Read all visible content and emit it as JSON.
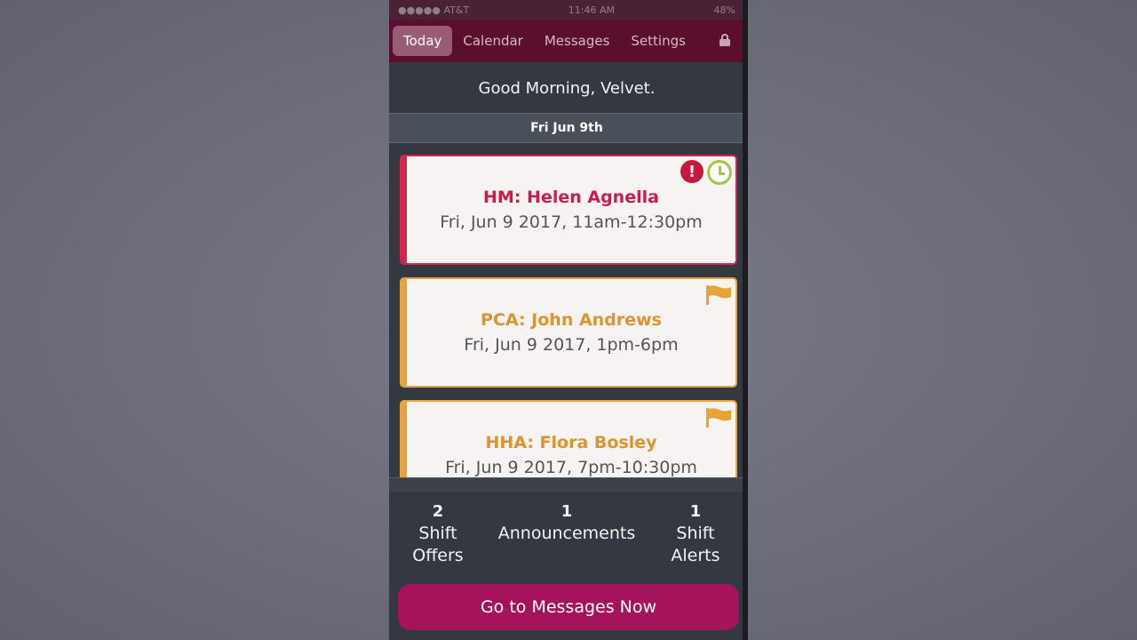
{
  "status_bar": {
    "carrier": "●●●●● AT&T",
    "time": "11:46 AM",
    "battery": "48%"
  },
  "nav": {
    "tabs": [
      {
        "label": "Today",
        "active": true
      },
      {
        "label": "Calendar",
        "active": false
      },
      {
        "label": "Messages",
        "active": false
      },
      {
        "label": "Settings",
        "active": false
      }
    ],
    "lock_icon": "lock-icon"
  },
  "greeting": "Good Morning, Velvet.",
  "date_header": "Fri Jun 9th",
  "shifts": [
    {
      "title": "HM: Helen Agnella",
      "time": "Fri, Jun 9 2017, 11am-12:30pm",
      "status_color": "#d52450",
      "icons": [
        "alert-icon",
        "clock-icon"
      ]
    },
    {
      "title": "PCA: John Andrews",
      "time": "Fri, Jun 9 2017, 1pm-6pm",
      "status_color": "#e8a23a",
      "icons": [
        "flag-icon"
      ]
    },
    {
      "title": "HHA: Flora Bosley",
      "time": "Fri, Jun 9 2017, 7pm-10:30pm",
      "status_color": "#e8a23a",
      "icons": [
        "flag-icon"
      ]
    }
  ],
  "summary": {
    "shift_offers": {
      "count": "2",
      "label": "Shift Offers"
    },
    "announcements": {
      "count": "1",
      "label": "Announcements"
    },
    "shift_alerts": {
      "count": "1",
      "label": "Shift Alerts"
    }
  },
  "cta_label": "Go to Messages Now",
  "colors": {
    "nav_bg": "#5a0f2c",
    "accent": "#a5135d",
    "alert_red": "#d52450",
    "flag_orange": "#e8a23a",
    "clock_green": "#a4c64a"
  }
}
